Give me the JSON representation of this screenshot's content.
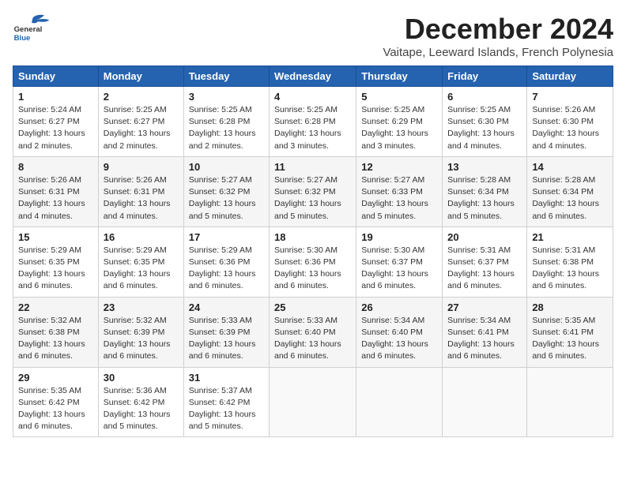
{
  "header": {
    "logo_general": "General",
    "logo_blue": "Blue",
    "month": "December 2024",
    "location": "Vaitape, Leeward Islands, French Polynesia"
  },
  "days_of_week": [
    "Sunday",
    "Monday",
    "Tuesday",
    "Wednesday",
    "Thursday",
    "Friday",
    "Saturday"
  ],
  "weeks": [
    [
      {
        "day": "1",
        "sunrise": "5:24 AM",
        "sunset": "6:27 PM",
        "daylight": "13 hours and 2 minutes."
      },
      {
        "day": "2",
        "sunrise": "5:25 AM",
        "sunset": "6:27 PM",
        "daylight": "13 hours and 2 minutes."
      },
      {
        "day": "3",
        "sunrise": "5:25 AM",
        "sunset": "6:28 PM",
        "daylight": "13 hours and 2 minutes."
      },
      {
        "day": "4",
        "sunrise": "5:25 AM",
        "sunset": "6:28 PM",
        "daylight": "13 hours and 3 minutes."
      },
      {
        "day": "5",
        "sunrise": "5:25 AM",
        "sunset": "6:29 PM",
        "daylight": "13 hours and 3 minutes."
      },
      {
        "day": "6",
        "sunrise": "5:25 AM",
        "sunset": "6:30 PM",
        "daylight": "13 hours and 4 minutes."
      },
      {
        "day": "7",
        "sunrise": "5:26 AM",
        "sunset": "6:30 PM",
        "daylight": "13 hours and 4 minutes."
      }
    ],
    [
      {
        "day": "8",
        "sunrise": "5:26 AM",
        "sunset": "6:31 PM",
        "daylight": "13 hours and 4 minutes."
      },
      {
        "day": "9",
        "sunrise": "5:26 AM",
        "sunset": "6:31 PM",
        "daylight": "13 hours and 4 minutes."
      },
      {
        "day": "10",
        "sunrise": "5:27 AM",
        "sunset": "6:32 PM",
        "daylight": "13 hours and 5 minutes."
      },
      {
        "day": "11",
        "sunrise": "5:27 AM",
        "sunset": "6:32 PM",
        "daylight": "13 hours and 5 minutes."
      },
      {
        "day": "12",
        "sunrise": "5:27 AM",
        "sunset": "6:33 PM",
        "daylight": "13 hours and 5 minutes."
      },
      {
        "day": "13",
        "sunrise": "5:28 AM",
        "sunset": "6:34 PM",
        "daylight": "13 hours and 5 minutes."
      },
      {
        "day": "14",
        "sunrise": "5:28 AM",
        "sunset": "6:34 PM",
        "daylight": "13 hours and 6 minutes."
      }
    ],
    [
      {
        "day": "15",
        "sunrise": "5:29 AM",
        "sunset": "6:35 PM",
        "daylight": "13 hours and 6 minutes."
      },
      {
        "day": "16",
        "sunrise": "5:29 AM",
        "sunset": "6:35 PM",
        "daylight": "13 hours and 6 minutes."
      },
      {
        "day": "17",
        "sunrise": "5:29 AM",
        "sunset": "6:36 PM",
        "daylight": "13 hours and 6 minutes."
      },
      {
        "day": "18",
        "sunrise": "5:30 AM",
        "sunset": "6:36 PM",
        "daylight": "13 hours and 6 minutes."
      },
      {
        "day": "19",
        "sunrise": "5:30 AM",
        "sunset": "6:37 PM",
        "daylight": "13 hours and 6 minutes."
      },
      {
        "day": "20",
        "sunrise": "5:31 AM",
        "sunset": "6:37 PM",
        "daylight": "13 hours and 6 minutes."
      },
      {
        "day": "21",
        "sunrise": "5:31 AM",
        "sunset": "6:38 PM",
        "daylight": "13 hours and 6 minutes."
      }
    ],
    [
      {
        "day": "22",
        "sunrise": "5:32 AM",
        "sunset": "6:38 PM",
        "daylight": "13 hours and 6 minutes."
      },
      {
        "day": "23",
        "sunrise": "5:32 AM",
        "sunset": "6:39 PM",
        "daylight": "13 hours and 6 minutes."
      },
      {
        "day": "24",
        "sunrise": "5:33 AM",
        "sunset": "6:39 PM",
        "daylight": "13 hours and 6 minutes."
      },
      {
        "day": "25",
        "sunrise": "5:33 AM",
        "sunset": "6:40 PM",
        "daylight": "13 hours and 6 minutes."
      },
      {
        "day": "26",
        "sunrise": "5:34 AM",
        "sunset": "6:40 PM",
        "daylight": "13 hours and 6 minutes."
      },
      {
        "day": "27",
        "sunrise": "5:34 AM",
        "sunset": "6:41 PM",
        "daylight": "13 hours and 6 minutes."
      },
      {
        "day": "28",
        "sunrise": "5:35 AM",
        "sunset": "6:41 PM",
        "daylight": "13 hours and 6 minutes."
      }
    ],
    [
      {
        "day": "29",
        "sunrise": "5:35 AM",
        "sunset": "6:42 PM",
        "daylight": "13 hours and 6 minutes."
      },
      {
        "day": "30",
        "sunrise": "5:36 AM",
        "sunset": "6:42 PM",
        "daylight": "13 hours and 5 minutes."
      },
      {
        "day": "31",
        "sunrise": "5:37 AM",
        "sunset": "6:42 PM",
        "daylight": "13 hours and 5 minutes."
      },
      null,
      null,
      null,
      null
    ]
  ],
  "labels": {
    "sunrise": "Sunrise:",
    "sunset": "Sunset:",
    "daylight": "Daylight:"
  }
}
